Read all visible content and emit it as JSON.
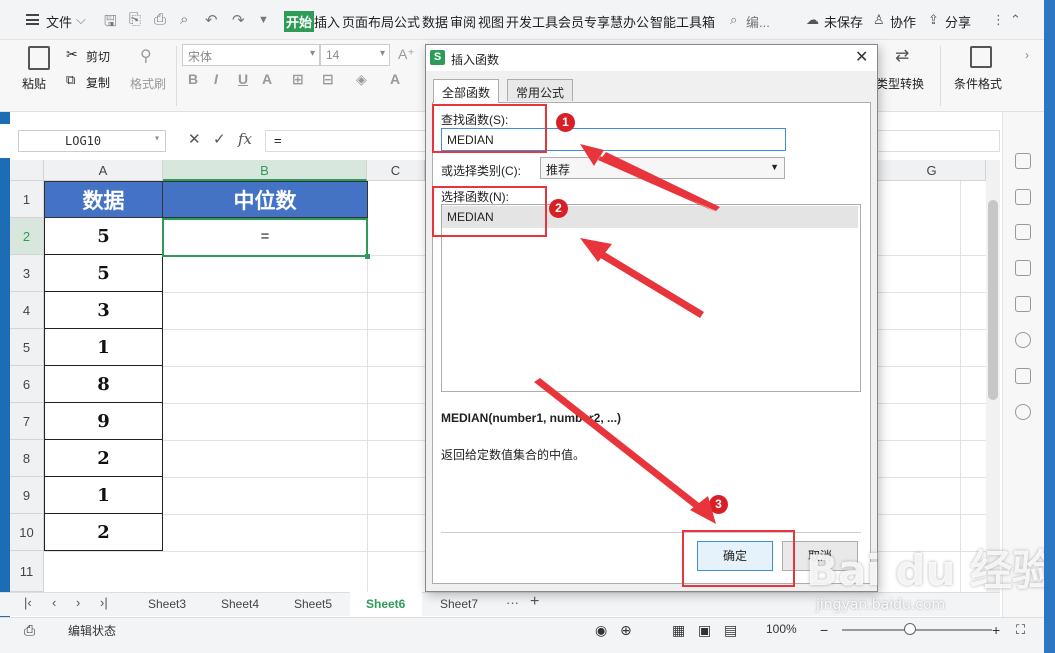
{
  "menubar": {
    "file_label": "文件",
    "tabs": [
      "开始",
      "插入",
      "页面布局",
      "公式",
      "数据",
      "审阅",
      "视图",
      "开发工具",
      "会员专享",
      "慧办公",
      "智能工具箱"
    ],
    "search_label": "编...",
    "unsaved_label": "未保存",
    "collab_label": "协作",
    "share_label": "分享"
  },
  "ribbon": {
    "paste_label": "粘贴",
    "cut_label": "剪切",
    "copy_label": "复制",
    "format_painter_label": "格式刷",
    "font_name": "宋体",
    "font_size": "14",
    "type_convert_label": "类型转换",
    "cond_format_label": "条件格式"
  },
  "formula_bar": {
    "name_box": "LOG10",
    "fx_label": "fx",
    "content": "="
  },
  "grid": {
    "columns": [
      "A",
      "B",
      "C",
      "G"
    ],
    "rows": [
      "1",
      "2",
      "3",
      "4",
      "5",
      "6",
      "7",
      "8",
      "9",
      "10",
      "11"
    ],
    "header_a": "数据",
    "header_b": "中位数",
    "values": [
      "5",
      "5",
      "3",
      "1",
      "8",
      "9",
      "2",
      "1",
      "2"
    ],
    "active_cell_content": "="
  },
  "sheets": {
    "tabs": [
      "Sheet3",
      "Sheet4",
      "Sheet5",
      "Sheet6",
      "Sheet7"
    ],
    "active": "Sheet6"
  },
  "status": {
    "mode": "编辑状态",
    "zoom": "100%"
  },
  "dialog": {
    "title": "插入函数",
    "tab_all": "全部函数",
    "tab_common": "常用公式",
    "search_label": "查找函数(S):",
    "search_value": "MEDIAN",
    "category_label": "或选择类别(C):",
    "category_value": "推荐",
    "select_label": "选择函数(N):",
    "selected_function": "MEDIAN",
    "signature": "MEDIAN(number1, number2, ...)",
    "description": "返回给定数值集合的中值。",
    "ok_label": "确定",
    "cancel_label": "取消"
  },
  "annotations": {
    "step1": "1",
    "step2": "2",
    "step3": "3",
    "color": "#e8353c"
  },
  "watermark": {
    "brand": "Bai du 经验",
    "url": "jingyan.baidu.com"
  },
  "colors": {
    "accent_green": "#2e9c58",
    "header_blue": "#4472c4",
    "annotation_red": "#e8353c"
  }
}
